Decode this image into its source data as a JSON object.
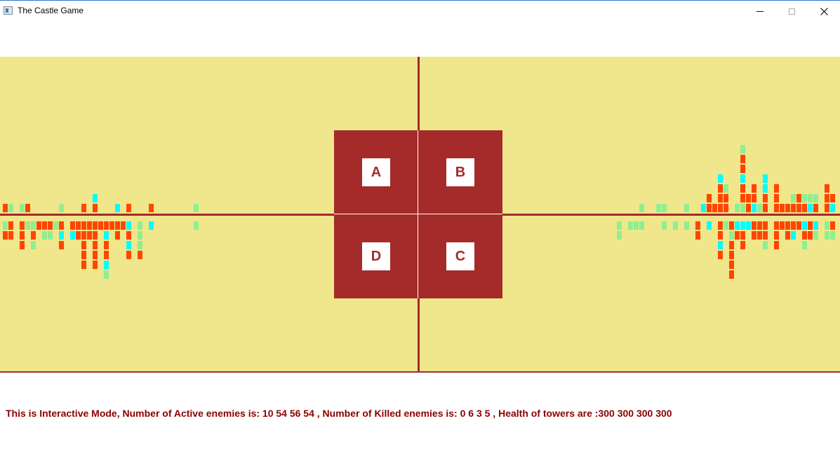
{
  "window": {
    "title": "The Castle Game",
    "icon": "app-window-icon",
    "controls": [
      "minimize-icon",
      "maximize-icon",
      "close-icon"
    ]
  },
  "colors": {
    "field": "#f0e68c",
    "castle": "#a52a2a",
    "tower_label_bg": "#ffffff",
    "status_text": "#8b0000",
    "enemy_types": [
      "#ff4500",
      "#90ee90",
      "#00ffff"
    ]
  },
  "towers": [
    {
      "label": "A",
      "health": 300
    },
    {
      "label": "B",
      "health": 300
    },
    {
      "label": "C",
      "health": 300
    },
    {
      "label": "D",
      "health": 300
    }
  ],
  "stats": {
    "mode": "Interactive",
    "active_enemies": [
      10,
      54,
      56,
      54
    ],
    "killed_enemies": [
      0,
      6,
      3,
      5
    ]
  },
  "status_text": "This is Interactive Mode, Number of Active enemies is: 10 54 56 54 , Number of Killed enemies is: 0 6 3 5 , Health of towers are :300 300 300 300"
}
